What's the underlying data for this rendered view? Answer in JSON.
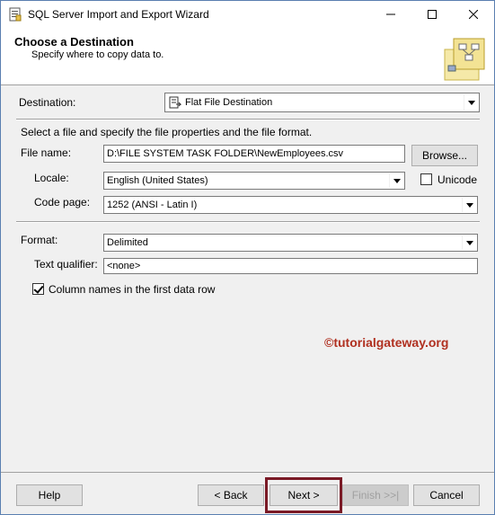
{
  "window": {
    "title": "SQL Server Import and Export Wizard",
    "controls": [
      "minimize",
      "maximize",
      "close"
    ]
  },
  "header": {
    "title": "Choose a Destination",
    "subtitle": "Specify where to copy data to."
  },
  "form": {
    "destination_label": "Destination:",
    "destination_value": "Flat File Destination",
    "instructions": "Select a file and specify the file properties and the file format.",
    "file_name_label": "File name:",
    "file_name_value": "D:\\FILE SYSTEM TASK FOLDER\\NewEmployees.csv",
    "browse_label": "Browse...",
    "locale_label": "Locale:",
    "locale_value": "English (United States)",
    "unicode_label": "Unicode",
    "unicode_checked": false,
    "code_page_label": "Code page:",
    "code_page_value": "1252  (ANSI - Latin I)",
    "format_label": "Format:",
    "format_value": "Delimited",
    "text_qualifier_label": "Text qualifier:",
    "text_qualifier_value": "<none>",
    "column_names_label": "Column names in the first data row",
    "column_names_checked": true
  },
  "watermark": "©tutorialgateway.org",
  "footer": {
    "help": "Help",
    "back": "< Back",
    "next": "Next >",
    "finish": "Finish >>|",
    "cancel": "Cancel"
  },
  "colors": {
    "highlight": "#7a1a26",
    "watermark": "#b03020"
  }
}
